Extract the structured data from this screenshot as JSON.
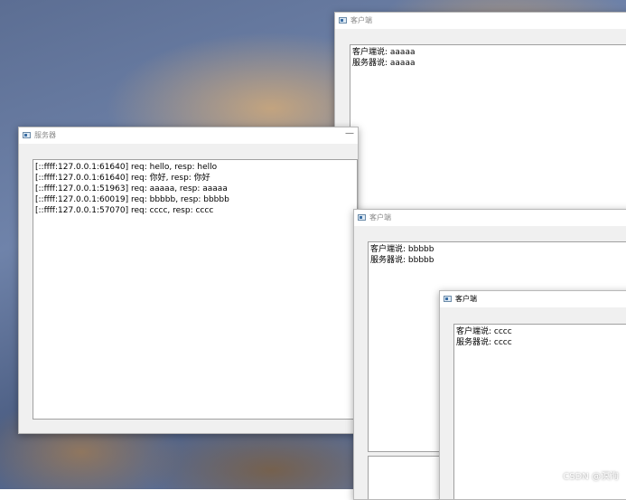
{
  "server_window": {
    "title": "服务器",
    "log": [
      "[::ffff:127.0.0.1:61640] req: hello, resp: hello",
      "[::ffff:127.0.0.1:61640] req: 你好, resp: 你好",
      "[::ffff:127.0.0.1:51963] req: aaaaa, resp: aaaaa",
      "[::ffff:127.0.0.1:60019] req: bbbbb, resp: bbbbb",
      "[::ffff:127.0.0.1:57070] req: cccc, resp: cccc"
    ]
  },
  "client_window_1": {
    "title": "客户端",
    "log": [
      "客户端说: aaaaa",
      "服务器说: aaaaa"
    ]
  },
  "client_window_2": {
    "title": "客户端",
    "log": [
      "客户端说: bbbbb",
      "服务器说: bbbbb"
    ]
  },
  "client_window_3": {
    "title": "客户端",
    "log": [
      "客户端说: cccc",
      "服务器说: cccc"
    ]
  },
  "watermark": "CSDN @溟洵"
}
